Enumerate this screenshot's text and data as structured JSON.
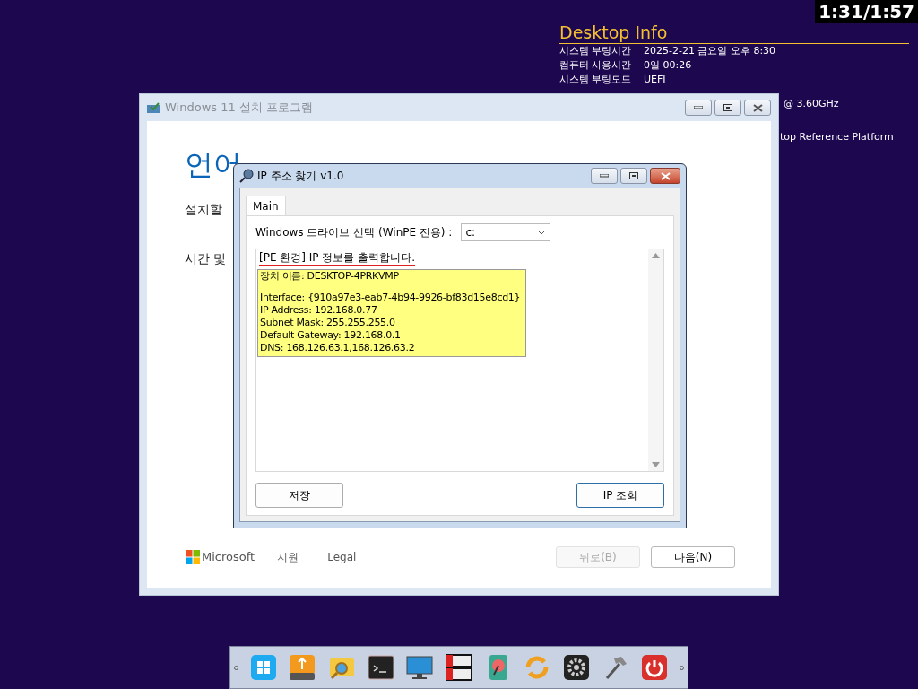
{
  "timer": "1:31/1:57",
  "desktop_info": {
    "title": "Desktop Info",
    "rows": [
      {
        "label": "시스템 부팅시간",
        "value": "2025-2-21 금요일 오후 8:30"
      },
      {
        "label": "컴퓨터 사용시간",
        "value": "0일 00:26"
      },
      {
        "label": "시스템 부팅모드",
        "value": "UEFI"
      }
    ],
    "fragments": [
      "@ 3.60GHz",
      "top Reference Platform"
    ]
  },
  "setup_window": {
    "title": "Windows 11 설치 프로그램",
    "heading": "언어",
    "lines": [
      "설치할",
      "시간 및"
    ],
    "footer_links": [
      "Microsoft",
      "지원",
      "Legal"
    ],
    "buttons": [
      {
        "label": "뒤로(B)",
        "disabled": true
      },
      {
        "label": "다음(N)",
        "disabled": false
      }
    ]
  },
  "dialog": {
    "title": "IP 주소 찾기 v1.0",
    "tabs": [
      {
        "label": "Main",
        "selected": true
      }
    ],
    "drive_label": "Windows 드라이브 선택 (WinPE 전용) :",
    "drive_value": "c:",
    "output_heading": "[PE 환경] IP 정보를 출력합니다.",
    "output_blocks": [
      [
        "장치 이름: DESKTOP-4PRKVMP"
      ],
      [
        "Interface: {910a97e3-eab7-4b94-9926-bf83d15e8cd1}",
        "IP Address: 192.168.0.77",
        "Subnet Mask: 255.255.255.0",
        "Default Gateway: 192.168.0.1",
        "DNS: 168.126.63.1,168.126.63.2"
      ]
    ],
    "buttons": [
      {
        "label": "저장",
        "default": false
      },
      {
        "label": "IP 조회",
        "default": true
      }
    ]
  }
}
